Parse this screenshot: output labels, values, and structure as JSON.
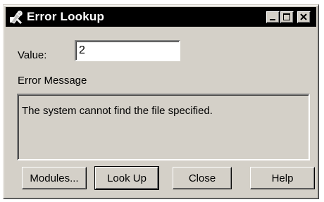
{
  "window": {
    "title": "Error Lookup",
    "icon": "tools-icon",
    "controls": {
      "minimize": "minimize-icon",
      "maximize": "maximize-icon",
      "close": "close-icon"
    }
  },
  "form": {
    "value_label": "Value:",
    "value_input": "2",
    "error_message_label": "Error Message",
    "error_message_text": "The system cannot find the file specified."
  },
  "buttons": {
    "modules": "Modules...",
    "look_up": "Look Up",
    "close": "Close",
    "help": "Help"
  }
}
